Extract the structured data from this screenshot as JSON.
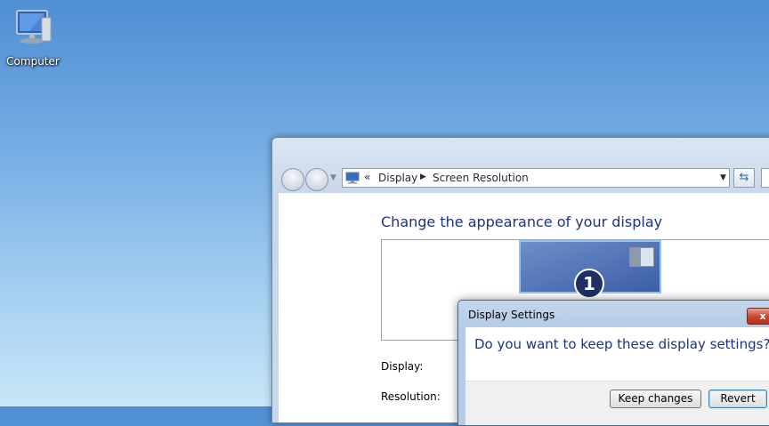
{
  "desktop": {
    "icons": [
      {
        "label": "Computer",
        "icon": "computer-icon"
      }
    ]
  },
  "window": {
    "address_bar": {
      "icon": "display-control-panel-icon",
      "overflow": "«",
      "breadcrumbs": [
        "Display",
        "Screen Resolution"
      ]
    },
    "heading": "Change the appearance of your display",
    "monitor_number": "1",
    "labels": {
      "display": "Display:",
      "resolution": "Resolution:"
    }
  },
  "dialog": {
    "title": "Display Settings",
    "question": "Do you want to keep these display settings?",
    "buttons": {
      "keep": "Keep changes",
      "revert": "Revert"
    },
    "close_symbol": "x"
  },
  "colors": {
    "heading_text": "#1e3287",
    "close_button": "#c8452a"
  }
}
